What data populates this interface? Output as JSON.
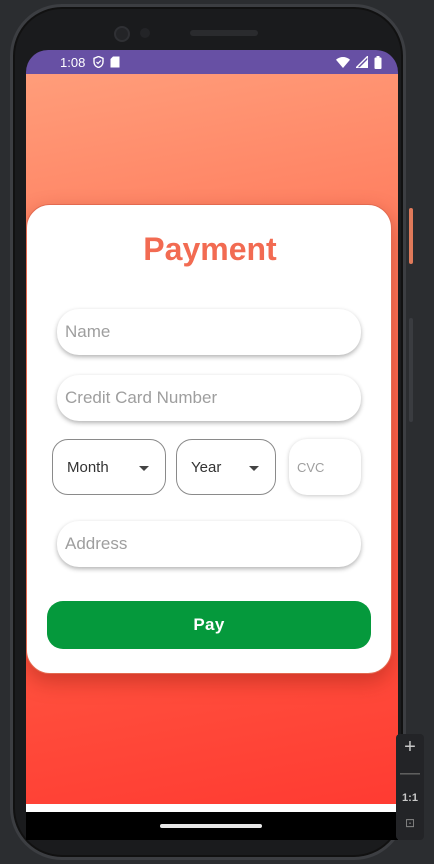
{
  "status_bar": {
    "time": "1:08",
    "left_icons": [
      "shield-icon",
      "sd-card-icon"
    ],
    "right_icons": [
      "wifi-icon",
      "signal-icon",
      "battery-icon"
    ],
    "color": "#6750a4"
  },
  "payment_form": {
    "title": "Payment",
    "name_placeholder": "Name",
    "card_number_placeholder": "Credit Card Number",
    "month_label": "Month",
    "year_label": "Year",
    "cvc_placeholder": "CVC",
    "address_placeholder": "Address",
    "pay_label": "Pay",
    "title_color": "#f26b52",
    "pay_color": "#05993c"
  },
  "emulator_toolbar": {
    "zoom_in": "+",
    "zoom_out": "—",
    "ratio": "1:1",
    "fit": "⊡"
  }
}
